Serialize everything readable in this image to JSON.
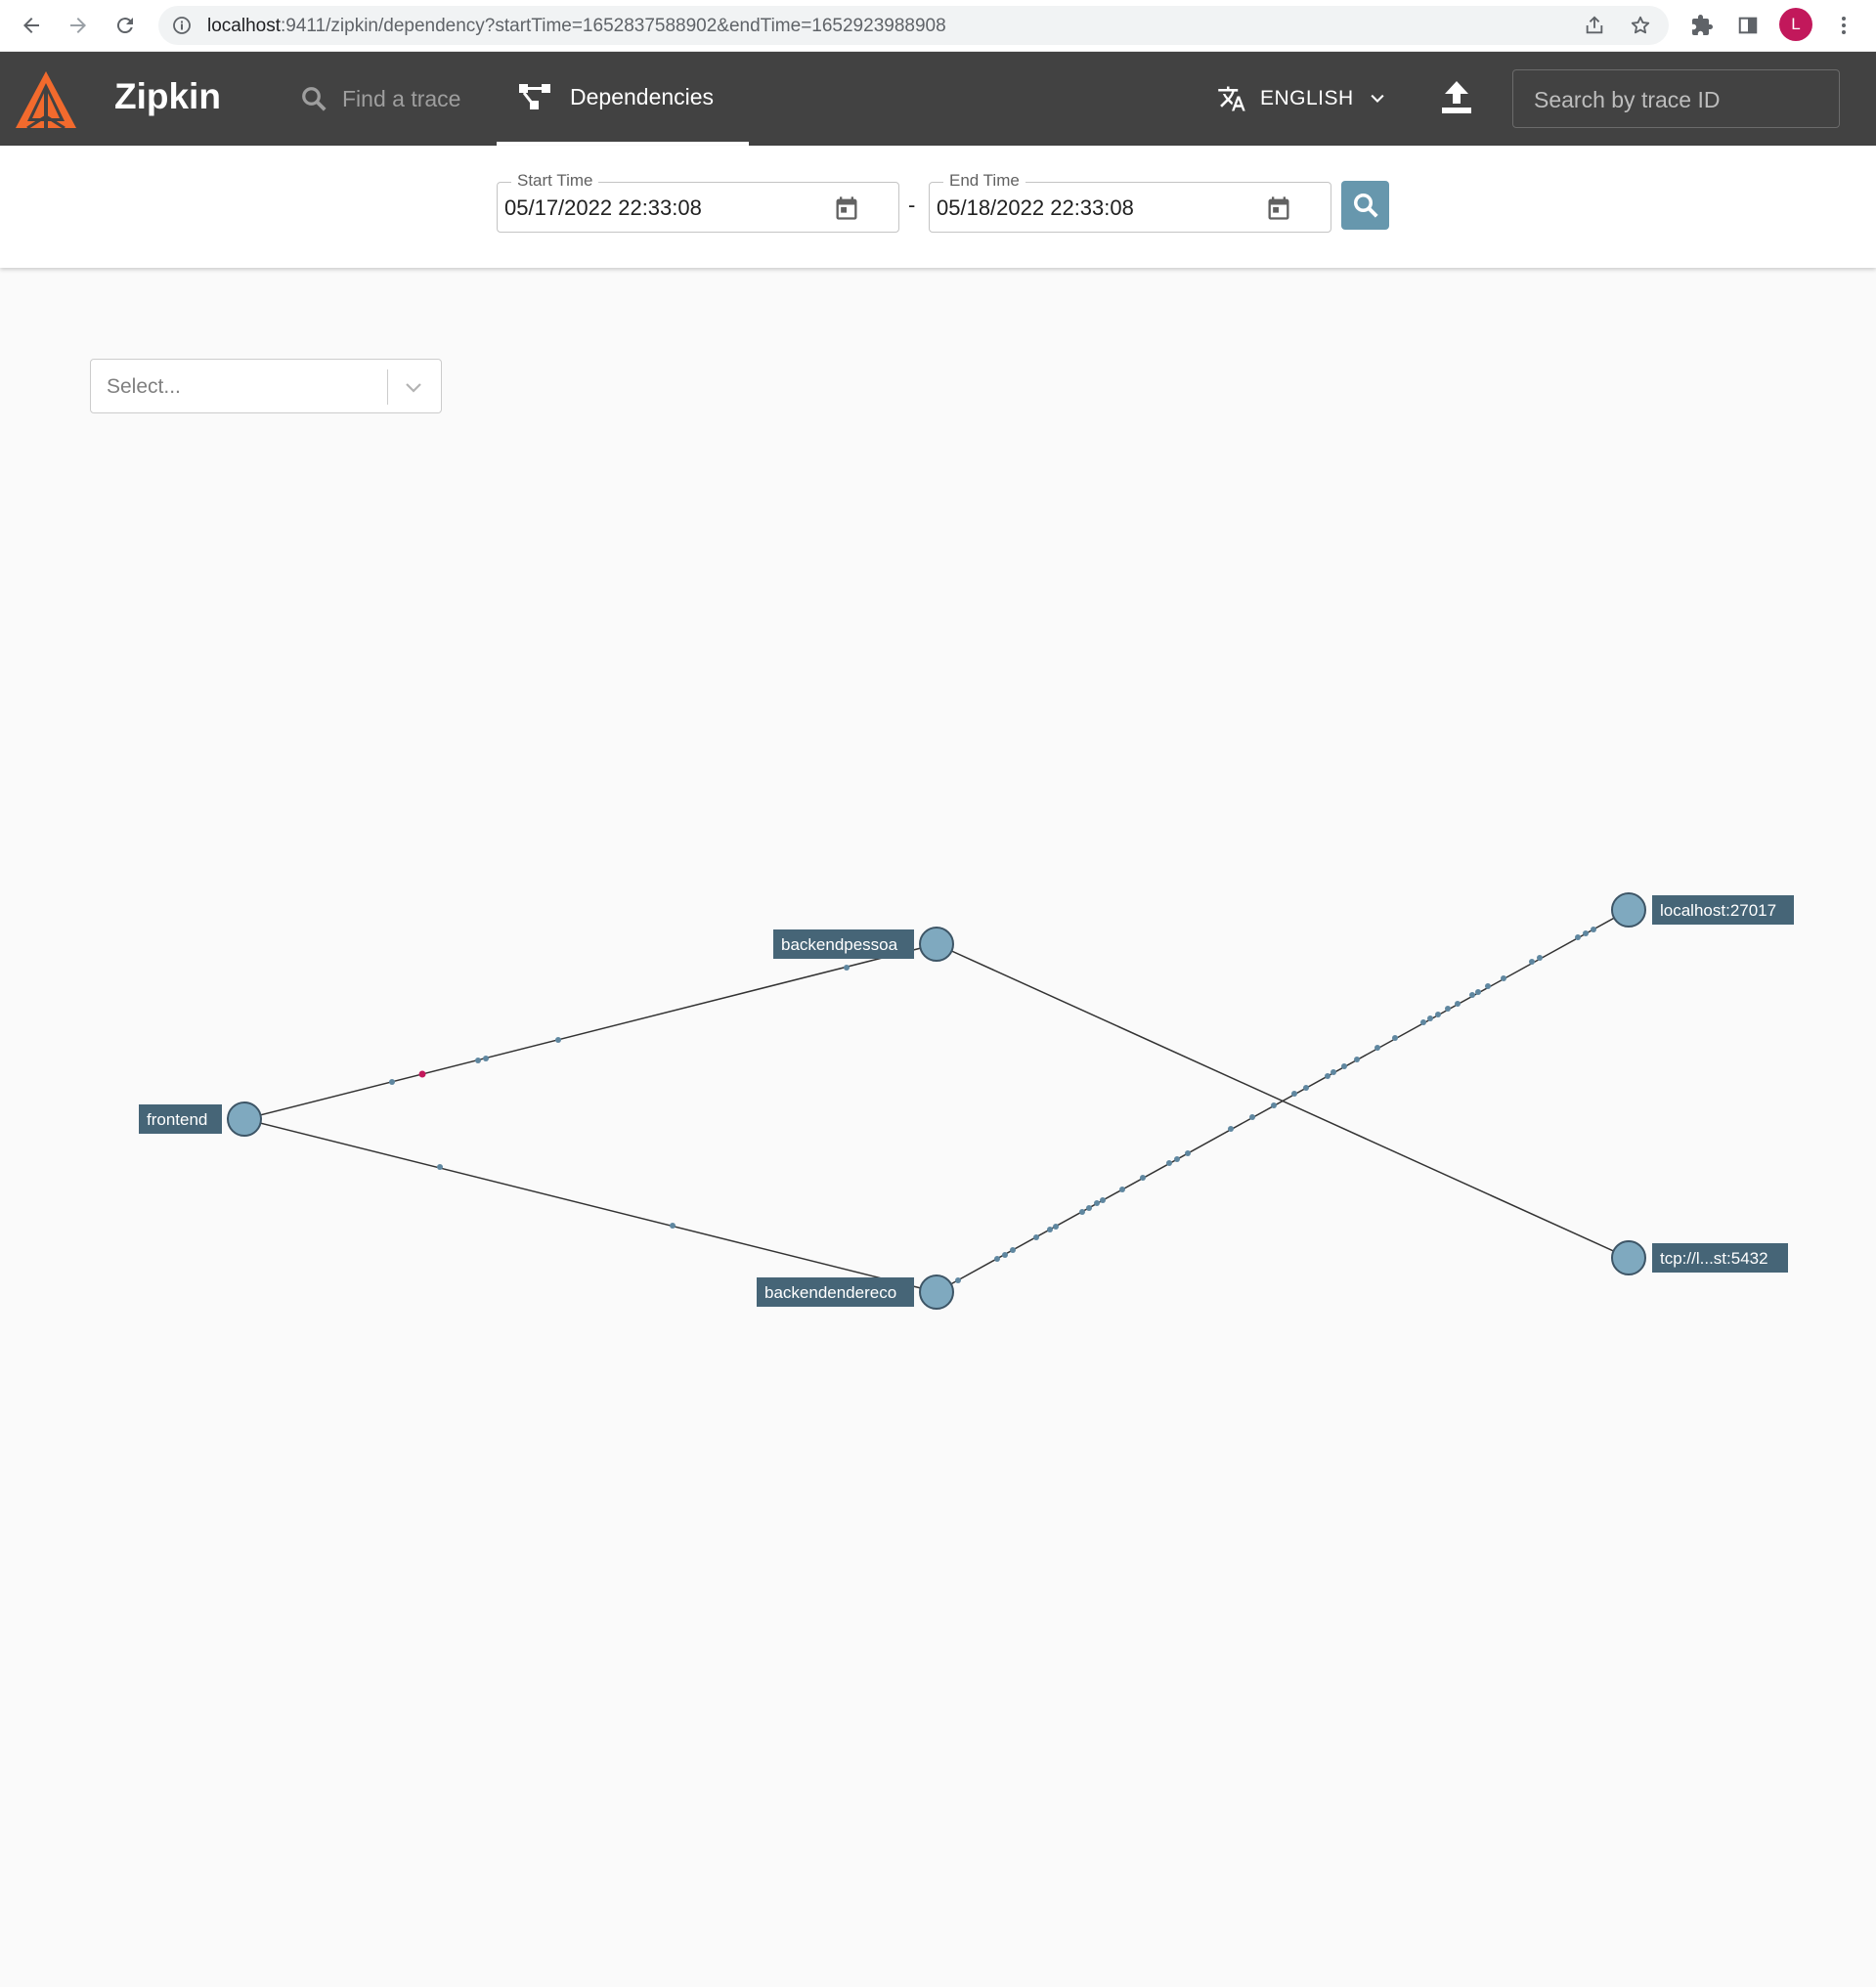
{
  "browser": {
    "url_host": "localhost",
    "url_rest": ":9411/zipkin/dependency?startTime=1652837588902&endTime=1652923988908",
    "profile_initial": "L"
  },
  "header": {
    "brand": "Zipkin",
    "nav": {
      "find_trace": "Find a trace",
      "dependencies": "Dependencies"
    },
    "language": "ENGLISH",
    "search_placeholder": "Search by trace ID"
  },
  "filters": {
    "start_time_label": "Start Time",
    "start_time_value": "05/17/2022 22:33:08",
    "separator": "-",
    "end_time_label": "End Time",
    "end_time_value": "05/18/2022 22:33:08"
  },
  "service_select": {
    "placeholder": "Select..."
  },
  "graph": {
    "nodes": {
      "frontend": "frontend",
      "backendpessoa": "backendpessoa",
      "backendendereco": "backendendereco",
      "mongo": "localhost:27017",
      "postgres": "tcp://l...st:5432"
    },
    "edges": [
      {
        "from": "frontend",
        "to": "backendpessoa",
        "has_error": true
      },
      {
        "from": "frontend",
        "to": "backendendereco",
        "has_error": false
      },
      {
        "from": "backendpessoa",
        "to": "tcp://l...st:5432",
        "has_error": false
      },
      {
        "from": "backendendereco",
        "to": "localhost:27017",
        "has_error": false
      }
    ]
  },
  "colors": {
    "appbar": "#424242",
    "accent": "#6797ad",
    "node_fill": "#7fa9bf",
    "label_bg": "#466577",
    "error_dot": "#c2185b"
  }
}
